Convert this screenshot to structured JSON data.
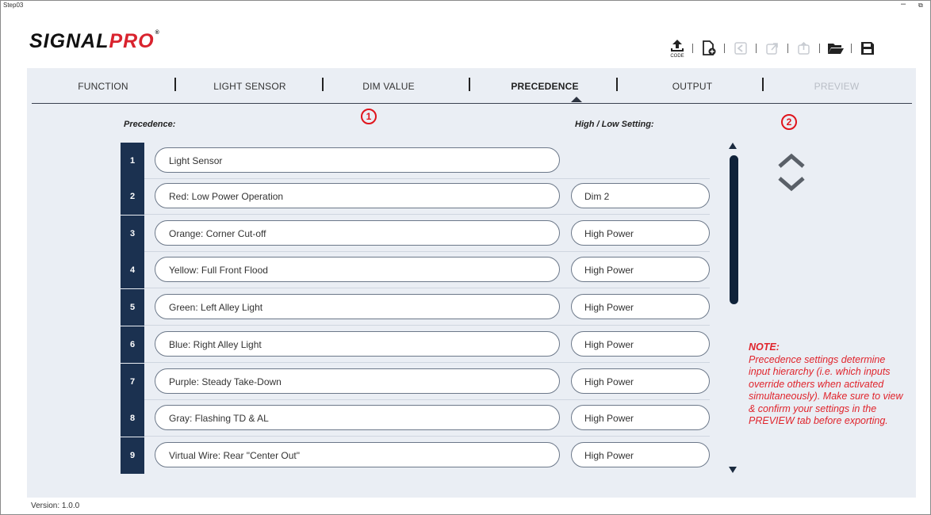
{
  "window": {
    "title": "Step03",
    "minimize": "–",
    "maximize": "⧉"
  },
  "logo": {
    "part1": "SIGNAL",
    "part2": "PRO",
    "reg": "®"
  },
  "toolbar": {
    "code_label": "CODE",
    "buttons": [
      "upload-code-icon",
      "new-file-icon",
      "undo-icon",
      "import-icon",
      "export-icon",
      "open-folder-icon",
      "save-icon"
    ]
  },
  "tabs": [
    {
      "label": "FUNCTION",
      "state": "normal"
    },
    {
      "label": "LIGHT SENSOR",
      "state": "normal"
    },
    {
      "label": "DIM VALUE",
      "state": "normal"
    },
    {
      "label": "PRECEDENCE",
      "state": "active"
    },
    {
      "label": "OUTPUT",
      "state": "normal"
    },
    {
      "label": "PREVIEW",
      "state": "disabled"
    }
  ],
  "labels": {
    "precedence": "Precedence:",
    "high_low": "High / Low Setting:",
    "marker1": "1",
    "marker2": "2"
  },
  "rows": [
    {
      "num": "1",
      "input": "Light Sensor",
      "setting": ""
    },
    {
      "num": "2",
      "input": "Red:  Low Power Operation",
      "setting": "Dim 2"
    },
    {
      "num": "3",
      "input": "Orange:  Corner Cut-off",
      "setting": "High Power"
    },
    {
      "num": "4",
      "input": "Yellow:  Full Front Flood",
      "setting": "High Power"
    },
    {
      "num": "5",
      "input": "Green:  Left Alley Light",
      "setting": "High Power"
    },
    {
      "num": "6",
      "input": "Blue:  Right Alley Light",
      "setting": "High Power"
    },
    {
      "num": "7",
      "input": "Purple:  Steady Take-Down",
      "setting": "High Power"
    },
    {
      "num": "8",
      "input": "Gray:  Flashing TD & AL",
      "setting": "High Power"
    },
    {
      "num": "9",
      "input": "Virtual Wire:  Rear \"Center Out\"",
      "setting": "High Power"
    }
  ],
  "note": {
    "title": "NOTE:",
    "text": "Precedence settings determine input hierarchy (i.e. which inputs override others when activated simultaneously). Make sure to view & confirm your settings in the PREVIEW tab before exporting."
  },
  "version": "Version: 1.0.0",
  "colors": {
    "accent": "#d9232e",
    "navy": "#1b3150",
    "note": "#e0242c",
    "content_bg": "#eaeef4"
  }
}
